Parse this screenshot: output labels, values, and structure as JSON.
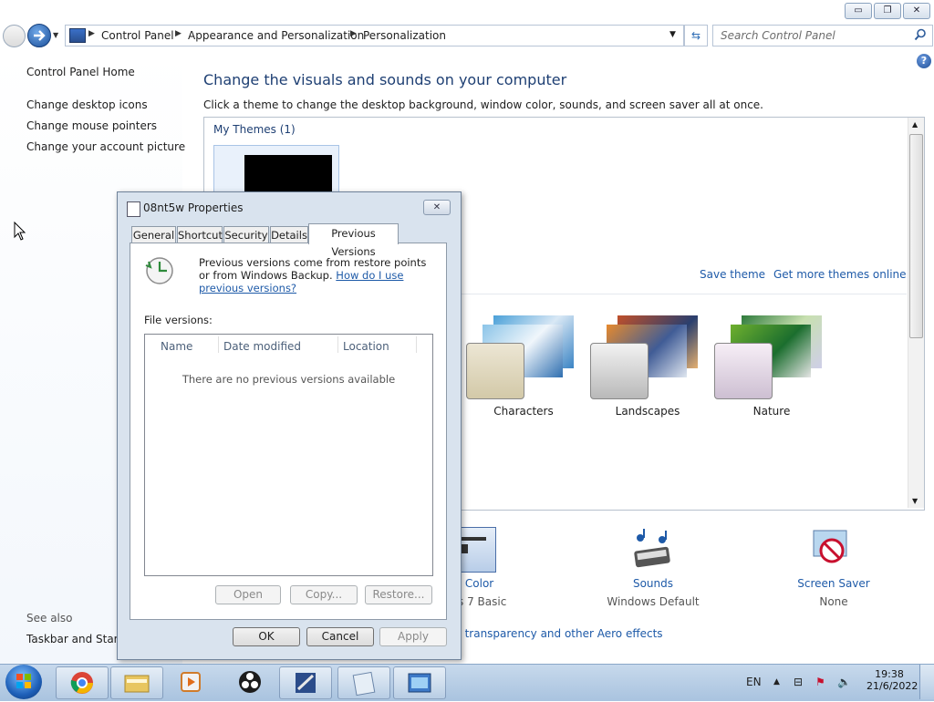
{
  "window": {
    "controls": {
      "minimize": "▭",
      "maximize": "❐",
      "close": "✕"
    }
  },
  "address": {
    "crumbs": [
      "Control Panel",
      "Appearance and Personalization",
      "Personalization"
    ],
    "search_placeholder": "Search Control Panel"
  },
  "nav": {
    "home": "Control Panel Home",
    "links": [
      "Change desktop icons",
      "Change mouse pointers",
      "Change your account picture"
    ],
    "see_also": "See also",
    "see_also_link": "Taskbar and Start Menu"
  },
  "content": {
    "title": "Change the visuals and sounds on your computer",
    "subtitle": "Click a theme to change the desktop background, window color, sounds, and screen saver all at once.",
    "my_themes": "My Themes (1)",
    "save_theme": "Save theme",
    "get_more": "Get more themes online",
    "themes": [
      "Characters",
      "Landscapes",
      "Nature"
    ],
    "bottom": {
      "window_color": "Window Color",
      "window_color_value": "Windows 7 Basic",
      "sounds": "Sounds",
      "sounds_value": "Windows Default",
      "screensaver": "Screen Saver",
      "screensaver_value": "None",
      "aero_link": "Troubleshoot problems with transparency and other Aero effects"
    }
  },
  "dialog": {
    "title": "08nt5w Properties",
    "tabs": [
      "General",
      "Shortcut",
      "Security",
      "Details",
      "Previous Versions"
    ],
    "active_tab": "Previous Versions",
    "info_text": "Previous versions come from restore points or from Windows Backup.",
    "info_link": "How do I use previous versions?",
    "file_versions_label": "File versions:",
    "columns": [
      "Name",
      "Date modified",
      "Location"
    ],
    "empty_msg": "There are no previous versions available",
    "buttons": {
      "open": "Open",
      "copy": "Copy...",
      "restore": "Restore...",
      "ok": "OK",
      "cancel": "Cancel",
      "apply": "Apply"
    }
  },
  "taskbar": {
    "lang": "EN",
    "time": "19:38",
    "date": "21/6/2022"
  },
  "colors": {
    "accent": "#1e5aa8",
    "title": "#1e3f73"
  }
}
